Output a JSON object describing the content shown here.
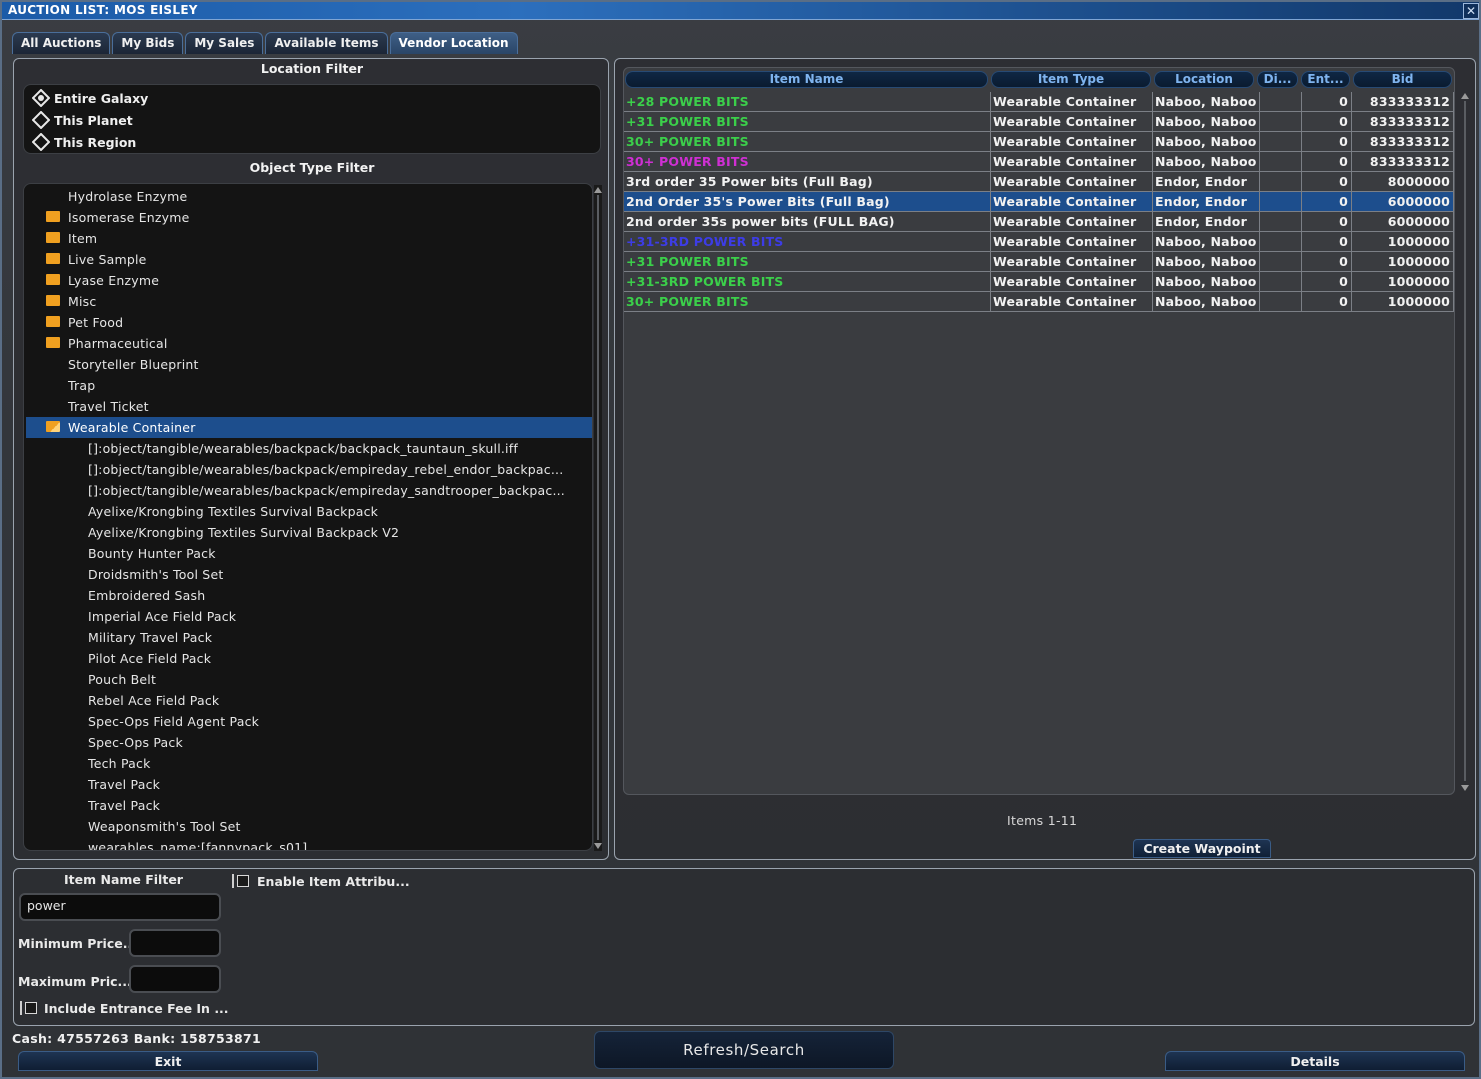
{
  "window": {
    "title": "AUCTION LIST: MOS EISLEY",
    "close_glyph": "✕"
  },
  "tabs": [
    {
      "label": "All Auctions"
    },
    {
      "label": "My Bids"
    },
    {
      "label": "My Sales"
    },
    {
      "label": "Available Items"
    },
    {
      "label": "Vendor Location",
      "active": true
    }
  ],
  "location_filter": {
    "title": "Location Filter",
    "options": [
      {
        "label": "Entire Galaxy",
        "selected": true
      },
      {
        "label": "This Planet",
        "selected": false
      },
      {
        "label": "This Region",
        "selected": false
      }
    ]
  },
  "object_type_filter": {
    "title": "Object Type Filter",
    "items": [
      {
        "label": "Hydrolase Enzyme",
        "folder": false,
        "indent": 0
      },
      {
        "label": "Isomerase Enzyme",
        "folder": true,
        "indent": 0
      },
      {
        "label": "Item",
        "folder": true,
        "indent": 0
      },
      {
        "label": "Live Sample",
        "folder": true,
        "indent": 0
      },
      {
        "label": "Lyase Enzyme",
        "folder": true,
        "indent": 0
      },
      {
        "label": "Misc",
        "folder": true,
        "indent": 0
      },
      {
        "label": "Pet Food",
        "folder": true,
        "indent": 0
      },
      {
        "label": "Pharmaceutical",
        "folder": true,
        "indent": 0
      },
      {
        "label": "Storyteller Blueprint",
        "folder": false,
        "indent": 0
      },
      {
        "label": "Trap",
        "folder": false,
        "indent": 0
      },
      {
        "label": "Travel Ticket",
        "folder": false,
        "indent": 0
      },
      {
        "label": "Wearable Container",
        "folder": true,
        "indent": 0,
        "selected": true,
        "open": true
      },
      {
        "label": "[]:object/tangible/wearables/backpack/backpack_tauntaun_skull.iff",
        "indent": 1
      },
      {
        "label": "[]:object/tangible/wearables/backpack/empireday_rebel_endor_backpac...",
        "indent": 1
      },
      {
        "label": "[]:object/tangible/wearables/backpack/empireday_sandtrooper_backpac...",
        "indent": 1
      },
      {
        "label": "Ayelixe/Krongbing Textiles Survival Backpack",
        "indent": 1
      },
      {
        "label": "Ayelixe/Krongbing Textiles Survival Backpack V2",
        "indent": 1
      },
      {
        "label": "Bounty Hunter Pack",
        "indent": 1
      },
      {
        "label": "Droidsmith's Tool Set",
        "indent": 1
      },
      {
        "label": "Embroidered Sash",
        "indent": 1
      },
      {
        "label": "Imperial Ace Field Pack",
        "indent": 1
      },
      {
        "label": "Military Travel Pack",
        "indent": 1
      },
      {
        "label": "Pilot Ace Field Pack",
        "indent": 1
      },
      {
        "label": "Pouch Belt",
        "indent": 1
      },
      {
        "label": "Rebel Ace Field Pack",
        "indent": 1
      },
      {
        "label": "Spec-Ops Field Agent Pack",
        "indent": 1
      },
      {
        "label": "Spec-Ops Pack",
        "indent": 1
      },
      {
        "label": "Tech Pack",
        "indent": 1
      },
      {
        "label": "Travel Pack",
        "indent": 1
      },
      {
        "label": "Travel Pack",
        "indent": 1
      },
      {
        "label": "Weaponsmith's Tool Set",
        "indent": 1
      },
      {
        "label": "wearables_name:[fannypack_s01]",
        "indent": 1
      }
    ]
  },
  "results": {
    "columns": [
      "Item Name",
      "Item Type",
      "Location",
      "Di...",
      "Ent...",
      "Bid"
    ],
    "rows": [
      {
        "name": "+28 POWER BITS",
        "color": "green",
        "type": "Wearable Container",
        "location": "Naboo, Naboo",
        "di": "",
        "ent": "0",
        "bid": "833333312"
      },
      {
        "name": "+31 POWER BITS",
        "color": "green",
        "type": "Wearable Container",
        "location": "Naboo, Naboo",
        "di": "",
        "ent": "0",
        "bid": "833333312"
      },
      {
        "name": "30+ POWER BITS",
        "color": "green",
        "type": "Wearable Container",
        "location": "Naboo, Naboo",
        "di": "",
        "ent": "0",
        "bid": "833333312"
      },
      {
        "name": "30+ POWER BITS",
        "color": "magenta",
        "type": "Wearable Container",
        "location": "Naboo, Naboo",
        "di": "",
        "ent": "0",
        "bid": "833333312"
      },
      {
        "name": "3rd order 35 Power bits (Full Bag)",
        "color": "white",
        "type": "Wearable Container",
        "location": "Endor, Endor",
        "di": "",
        "ent": "0",
        "bid": "8000000"
      },
      {
        "name": "2nd Order 35's Power Bits (Full Bag)",
        "color": "white",
        "type": "Wearable Container",
        "location": "Endor, Endor",
        "di": "",
        "ent": "0",
        "bid": "6000000",
        "selected": true
      },
      {
        "name": "2nd order 35s power bits (FULL BAG)",
        "color": "white",
        "type": "Wearable Container",
        "location": "Endor, Endor",
        "di": "",
        "ent": "0",
        "bid": "6000000"
      },
      {
        "name": "+31-3RD POWER BITS",
        "color": "blue",
        "type": "Wearable Container",
        "location": "Naboo, Naboo",
        "di": "",
        "ent": "0",
        "bid": "1000000"
      },
      {
        "name": "+31 POWER BITS",
        "color": "green",
        "type": "Wearable Container",
        "location": "Naboo, Naboo",
        "di": "",
        "ent": "0",
        "bid": "1000000"
      },
      {
        "name": "+31-3RD POWER BITS",
        "color": "green",
        "type": "Wearable Container",
        "location": "Naboo, Naboo",
        "di": "",
        "ent": "0",
        "bid": "1000000"
      },
      {
        "name": "30+ POWER BITS",
        "color": "green",
        "type": "Wearable Container",
        "location": "Naboo, Naboo",
        "di": "",
        "ent": "0",
        "bid": "1000000"
      }
    ],
    "items_count": "Items 1-11",
    "create_waypoint": "Create Waypoint"
  },
  "filters": {
    "item_name_label": "Item Name Filter",
    "item_name_value": "power",
    "enable_attrib_label": "Enable Item Attribu...",
    "min_price_label": "Minimum Price...",
    "max_price_label": "Maximum Pric...",
    "include_fee_label": "Include Entrance Fee In ..."
  },
  "footer": {
    "cash_text": "Cash:  47557263  Bank:  158753871",
    "exit_label": "Exit",
    "refresh_label": "Refresh/Search",
    "details_label": "Details"
  },
  "colors": {
    "accent": "#1d4e8d",
    "header_text": "#7fb4ef",
    "green": "#3bd04a",
    "magenta": "#d02ed4",
    "blue": "#3d3ce6",
    "folder": "#f0a020"
  }
}
